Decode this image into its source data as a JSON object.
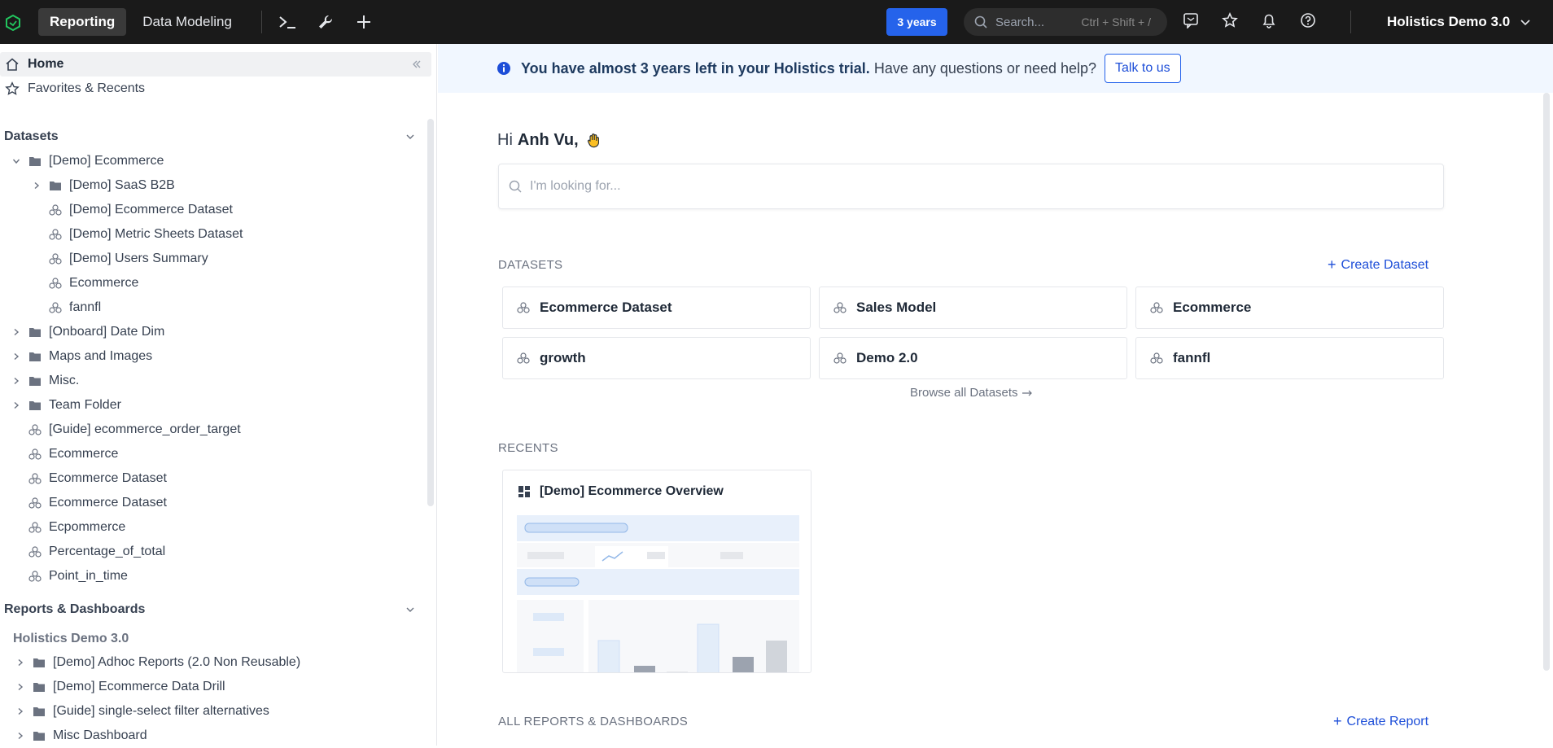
{
  "topbar": {
    "tabs": [
      {
        "label": "Reporting",
        "active": true
      },
      {
        "label": "Data Modeling",
        "active": false
      }
    ],
    "icons": [
      "terminal-icon",
      "wrench-icon",
      "plus-icon"
    ],
    "trial_badge": "3 years",
    "search": {
      "placeholder": "Search...",
      "shortcut": "Ctrl + Shift + /"
    },
    "right_icons": [
      "feedback-icon",
      "star-icon",
      "bell-icon",
      "help-icon"
    ],
    "account_name": "Holistics Demo 3.0",
    "accent_color": "#2563eb"
  },
  "sidebar": {
    "home": "Home",
    "favorites": "Favorites & Recents",
    "datasets_header": "Datasets",
    "datasets_tree": [
      {
        "label": "[Demo] Ecommerce",
        "type": "folder",
        "expanded": true,
        "depth": 0
      },
      {
        "label": "[Demo] SaaS B2B",
        "type": "folder",
        "expanded": false,
        "depth": 1
      },
      {
        "label": "[Demo] Ecommerce Dataset",
        "type": "dataset",
        "depth": 1
      },
      {
        "label": "[Demo] Metric Sheets Dataset",
        "type": "dataset",
        "depth": 1
      },
      {
        "label": "[Demo] Users Summary",
        "type": "dataset",
        "depth": 1
      },
      {
        "label": "Ecommerce",
        "type": "dataset",
        "depth": 1
      },
      {
        "label": "fannfl",
        "type": "dataset",
        "depth": 1
      },
      {
        "label": "[Onboard] Date Dim",
        "type": "folder",
        "expanded": false,
        "depth": 0
      },
      {
        "label": "Maps and Images",
        "type": "folder",
        "expanded": false,
        "depth": 0
      },
      {
        "label": "Misc.",
        "type": "folder",
        "expanded": false,
        "depth": 0
      },
      {
        "label": "Team Folder",
        "type": "folder",
        "expanded": false,
        "depth": 0
      },
      {
        "label": "[Guide] ecommerce_order_target",
        "type": "dataset",
        "depth": 0
      },
      {
        "label": "Ecommerce",
        "type": "dataset",
        "depth": 0
      },
      {
        "label": "Ecommerce Dataset",
        "type": "dataset",
        "depth": 0
      },
      {
        "label": "Ecommerce Dataset",
        "type": "dataset",
        "depth": 0
      },
      {
        "label": "Ecpommerce",
        "type": "dataset",
        "depth": 0
      },
      {
        "label": "Percentage_of_total",
        "type": "dataset",
        "depth": 0
      },
      {
        "label": "Point_in_time",
        "type": "dataset",
        "depth": 0
      }
    ],
    "reports_header": "Reports & Dashboards",
    "org_name": "Holistics Demo 3.0",
    "reports_tree": [
      {
        "label": "[Demo] Adhoc Reports (2.0 Non Reusable)",
        "type": "folder"
      },
      {
        "label": "[Demo] Ecommerce Data Drill",
        "type": "folder"
      },
      {
        "label": "[Guide] single-select filter alternatives",
        "type": "folder"
      },
      {
        "label": "Misc Dashboard",
        "type": "folder"
      }
    ]
  },
  "banner": {
    "strong": "You have almost 3 years left in your Holistics trial.",
    "rest": "Have any questions or need help?",
    "button": "Talk to us"
  },
  "main": {
    "greeting": "Hi",
    "user_name": "Anh Vu,",
    "search_placeholder": "I'm looking for...",
    "datasets_title": "DATASETS",
    "create_dataset": "Create Dataset",
    "dataset_cards": [
      "Ecommerce Dataset",
      "Sales Model",
      "Ecommerce",
      "growth",
      "Demo 2.0",
      "fannfl"
    ],
    "browse_all": "Browse all Datasets",
    "recents_title": "RECENTS",
    "recent_cards": [
      "[Demo] Ecommerce Overview"
    ],
    "all_reports_title": "ALL REPORTS & DASHBOARDS",
    "create_report": "Create Report"
  }
}
